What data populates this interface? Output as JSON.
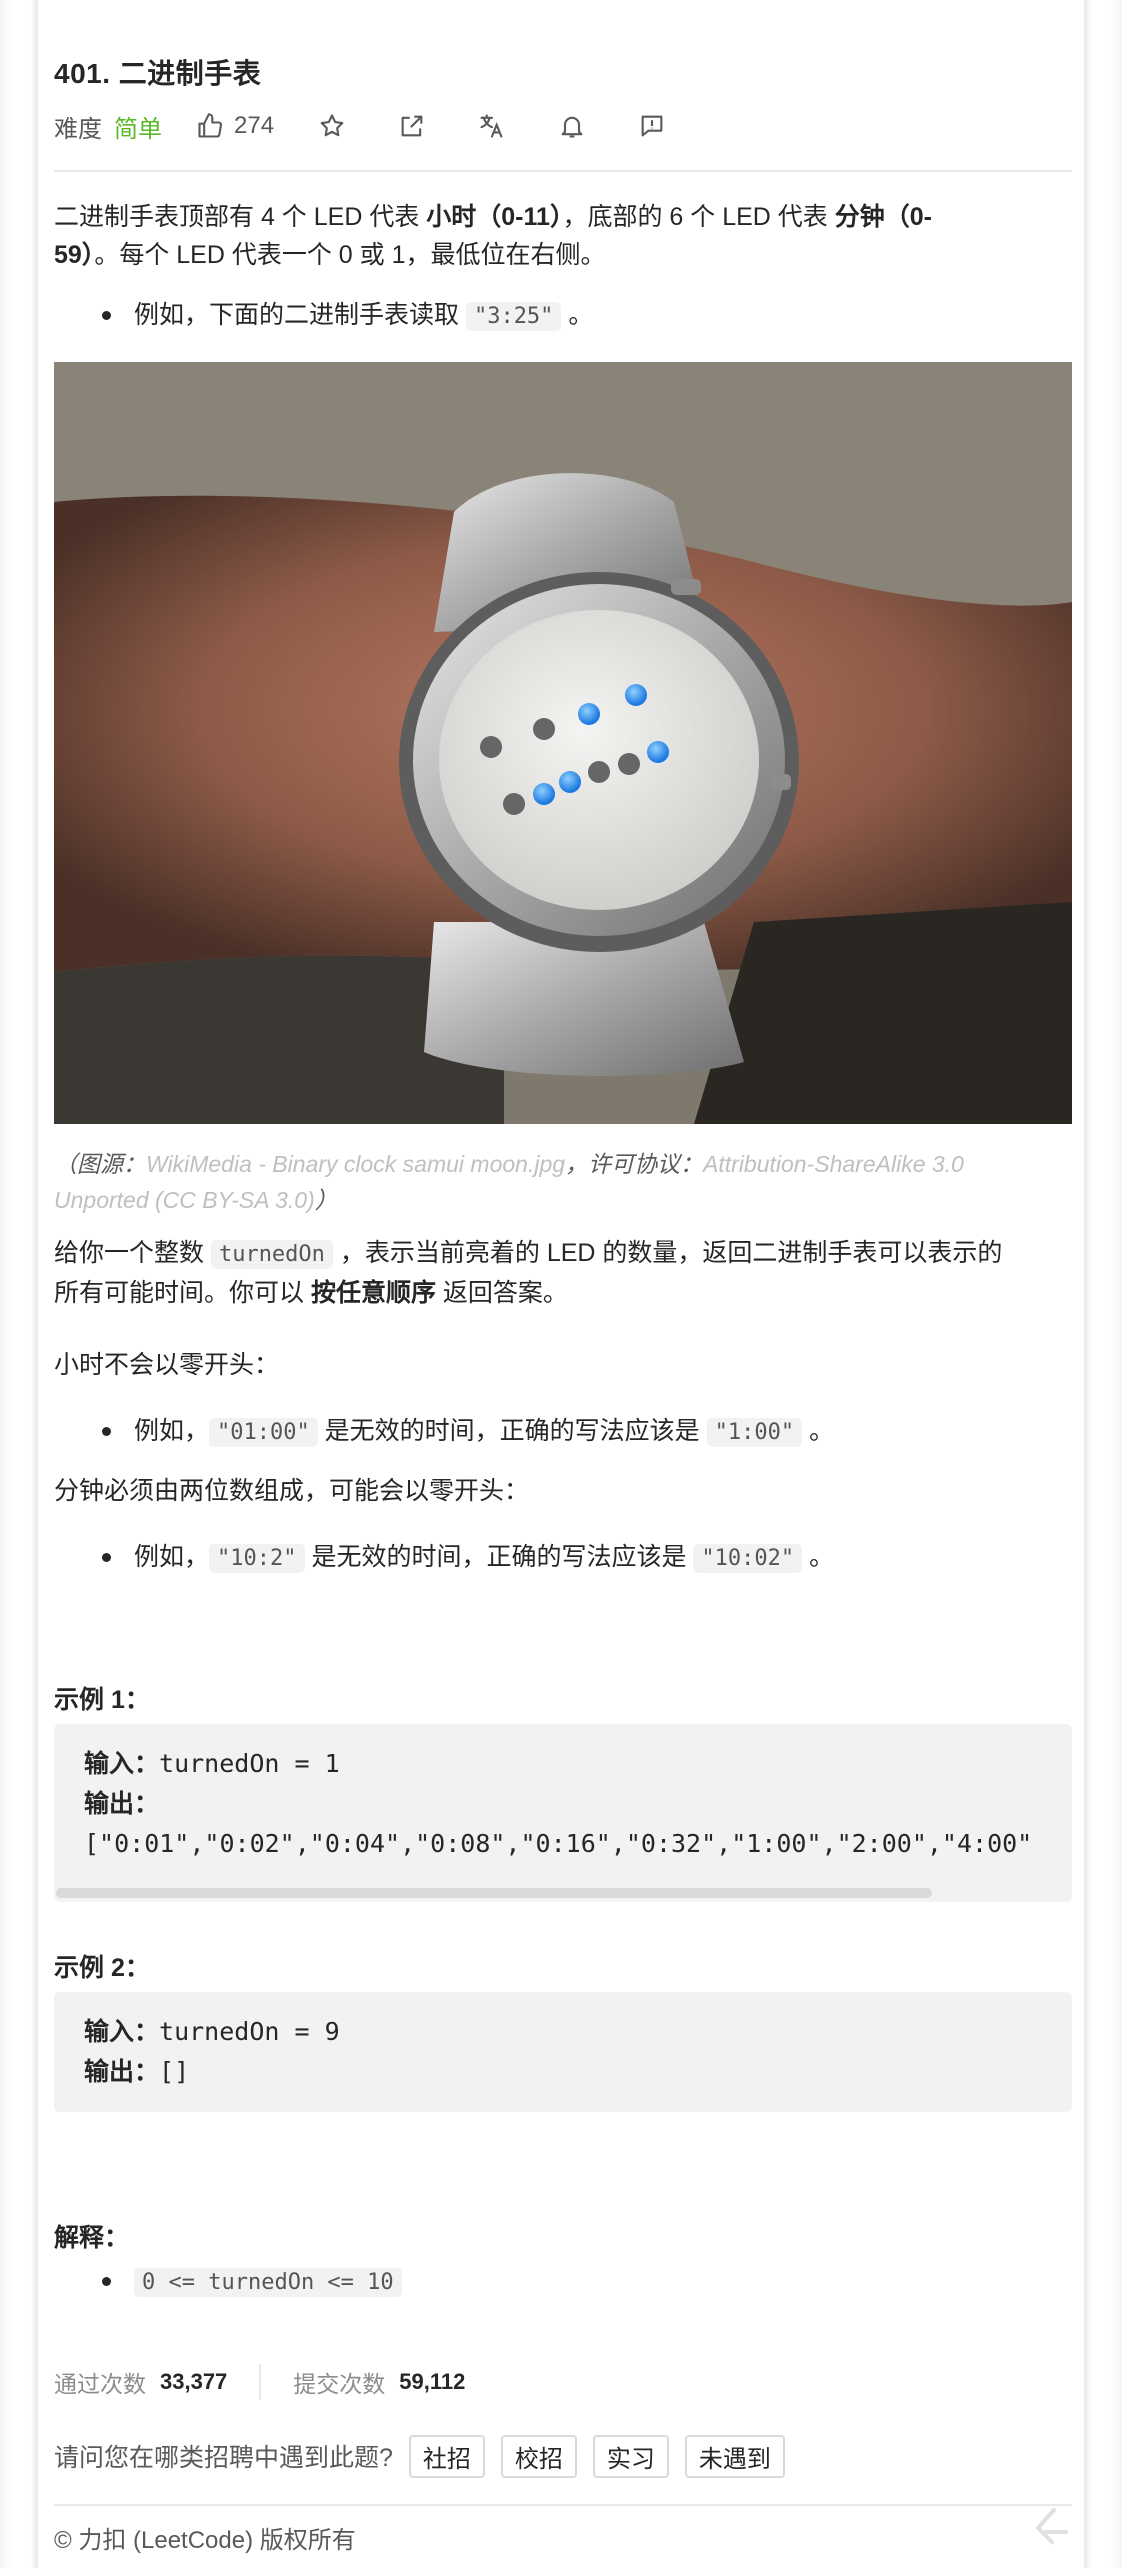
{
  "problem": {
    "title": "401. 二进制手表",
    "difficulty_label": "难度",
    "difficulty": "简单",
    "likes": "274"
  },
  "icons": {
    "like": "thumbs-up-icon",
    "favorite": "star-icon",
    "share": "share-icon",
    "translate": "translate-icon",
    "notify": "bell-icon",
    "feedback": "feedback-icon"
  },
  "description": {
    "p1_a": "二进制手表顶部有 4 个 LED 代表 ",
    "p1_b": "小时（0-11）",
    "p1_c": "，底部的 6 个 LED 代表 ",
    "p1_d": "分钟（0-",
    "p1_e": "59）",
    "p1_f": "。每个 LED 代表一个 0 或 1，最低位在右侧。",
    "bullet1_a": "例如，下面的二进制手表读取 ",
    "bullet1_code": "\"3:25\"",
    "bullet1_b": " 。",
    "caption_open": "（图源：",
    "caption_source": "WikiMedia - Binary clock samui moon.jpg",
    "caption_mid": "，许可协议：",
    "caption_license_1": "Attribution-ShareAlike 3.0",
    "caption_license_2": "Unported (CC BY-SA 3.0)",
    "caption_close": "）",
    "p2_a": "给你一个整数 ",
    "p2_code": "turnedOn",
    "p2_b": " ，表示当前亮着的 LED 的数量，返回二进制手表可以表示的",
    "p2_c": "所有可能时间。你可以 ",
    "p2_bold": "按任意顺序",
    "p2_d": " 返回答案。",
    "p3": "小时不会以零开头：",
    "bullet2_a": "例如，",
    "bullet2_code1": "\"01:00\"",
    "bullet2_b": " 是无效的时间，正确的写法应该是 ",
    "bullet2_code2": "\"1:00\"",
    "bullet2_c": " 。",
    "p4": "分钟必须由两位数组成，可能会以零开头：",
    "bullet3_a": "例如，",
    "bullet3_code1": "\"10:2\"",
    "bullet3_b": " 是无效的时间，正确的写法应该是 ",
    "bullet3_code2": "\"10:02\"",
    "bullet3_c": " 。"
  },
  "examples": [
    {
      "heading": "示例 1：",
      "input_label": "输入：",
      "input": "turnedOn = 1",
      "output_label": "输出：",
      "output": "[\"0:01\",\"0:02\",\"0:04\",\"0:08\",\"0:16\",\"0:32\",\"1:00\",\"2:00\",\"4:00\""
    },
    {
      "heading": "示例 2：",
      "input_label": "输入：",
      "input": "turnedOn = 9",
      "output_label": "输出：",
      "output": "[]"
    }
  ],
  "constraints": {
    "heading": "解释：",
    "item": "0 <= turnedOn <= 10"
  },
  "stats": {
    "accepted_label": "通过次数",
    "accepted": "33,377",
    "submissions_label": "提交次数",
    "submissions": "59,112"
  },
  "hiring": {
    "question": "请问您在哪类招聘中遇到此题?",
    "options": [
      "社招",
      "校招",
      "实习",
      "未遇到"
    ]
  },
  "footer": {
    "copyright": "© 力扣 (LeetCode) 版权所有"
  },
  "colors": {
    "easy": "#5ab726",
    "code_bg": "#f2f2f2",
    "led_blue": "#2f9bff"
  }
}
